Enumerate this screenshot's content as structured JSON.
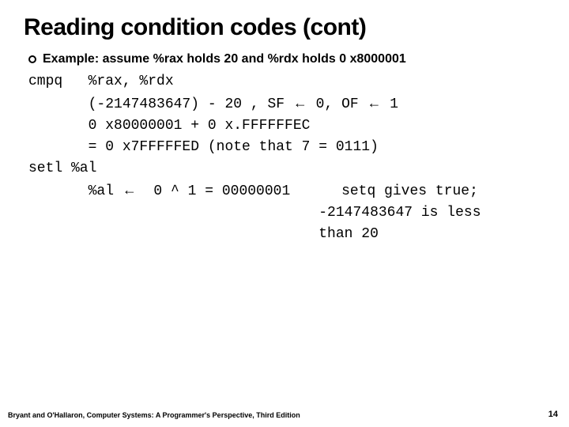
{
  "title": "Reading condition codes (cont)",
  "bullet": "Example:  assume %rax holds 20 and %rdx  holds 0 x8000001",
  "code": {
    "l1": "cmpq   %rax, %rdx",
    "l2a": "       (-2147483647) - 20 , SF ",
    "l2b": " 0, OF ",
    "l2c": " 1",
    "l3": "       0 x80000001 + 0 x.FFFFFFEC",
    "l4": "       = 0 x7FFFFFED (note that 7 = 0111)",
    "l5": "setl %al",
    "l6a": "       %al ",
    "l6b": "  0 ^ 1 = 00000001      setq gives true;",
    "l7": "                                  -2147483647 is less",
    "l8": "                                  than 20"
  },
  "arrow": "←",
  "footer": "Bryant and O'Hallaron, Computer Systems: A Programmer's Perspective, Third Edition",
  "page": "14"
}
